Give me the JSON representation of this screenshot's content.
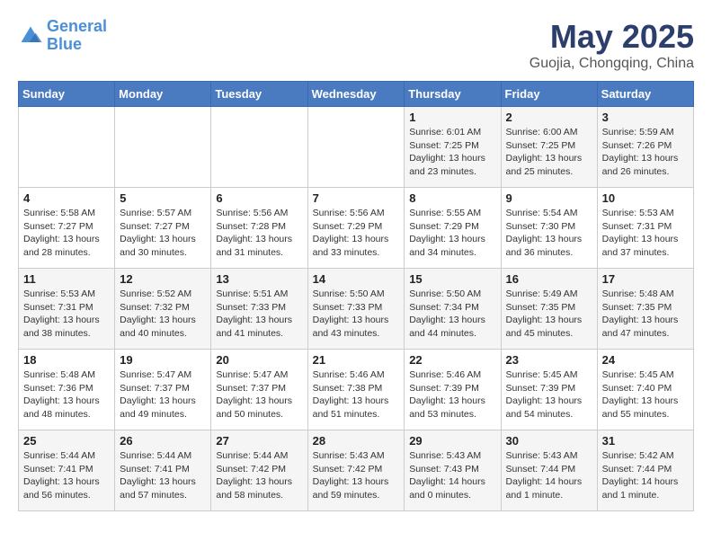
{
  "logo": {
    "line1": "General",
    "line2": "Blue"
  },
  "title": "May 2025",
  "subtitle": "Guojia, Chongqing, China",
  "days_of_week": [
    "Sunday",
    "Monday",
    "Tuesday",
    "Wednesday",
    "Thursday",
    "Friday",
    "Saturday"
  ],
  "weeks": [
    [
      {
        "day": "",
        "sunrise": "",
        "sunset": "",
        "daylight": ""
      },
      {
        "day": "",
        "sunrise": "",
        "sunset": "",
        "daylight": ""
      },
      {
        "day": "",
        "sunrise": "",
        "sunset": "",
        "daylight": ""
      },
      {
        "day": "",
        "sunrise": "",
        "sunset": "",
        "daylight": ""
      },
      {
        "day": "1",
        "sunrise": "Sunrise: 6:01 AM",
        "sunset": "Sunset: 7:25 PM",
        "daylight": "Daylight: 13 hours and 23 minutes."
      },
      {
        "day": "2",
        "sunrise": "Sunrise: 6:00 AM",
        "sunset": "Sunset: 7:25 PM",
        "daylight": "Daylight: 13 hours and 25 minutes."
      },
      {
        "day": "3",
        "sunrise": "Sunrise: 5:59 AM",
        "sunset": "Sunset: 7:26 PM",
        "daylight": "Daylight: 13 hours and 26 minutes."
      }
    ],
    [
      {
        "day": "4",
        "sunrise": "Sunrise: 5:58 AM",
        "sunset": "Sunset: 7:27 PM",
        "daylight": "Daylight: 13 hours and 28 minutes."
      },
      {
        "day": "5",
        "sunrise": "Sunrise: 5:57 AM",
        "sunset": "Sunset: 7:27 PM",
        "daylight": "Daylight: 13 hours and 30 minutes."
      },
      {
        "day": "6",
        "sunrise": "Sunrise: 5:56 AM",
        "sunset": "Sunset: 7:28 PM",
        "daylight": "Daylight: 13 hours and 31 minutes."
      },
      {
        "day": "7",
        "sunrise": "Sunrise: 5:56 AM",
        "sunset": "Sunset: 7:29 PM",
        "daylight": "Daylight: 13 hours and 33 minutes."
      },
      {
        "day": "8",
        "sunrise": "Sunrise: 5:55 AM",
        "sunset": "Sunset: 7:29 PM",
        "daylight": "Daylight: 13 hours and 34 minutes."
      },
      {
        "day": "9",
        "sunrise": "Sunrise: 5:54 AM",
        "sunset": "Sunset: 7:30 PM",
        "daylight": "Daylight: 13 hours and 36 minutes."
      },
      {
        "day": "10",
        "sunrise": "Sunrise: 5:53 AM",
        "sunset": "Sunset: 7:31 PM",
        "daylight": "Daylight: 13 hours and 37 minutes."
      }
    ],
    [
      {
        "day": "11",
        "sunrise": "Sunrise: 5:53 AM",
        "sunset": "Sunset: 7:31 PM",
        "daylight": "Daylight: 13 hours and 38 minutes."
      },
      {
        "day": "12",
        "sunrise": "Sunrise: 5:52 AM",
        "sunset": "Sunset: 7:32 PM",
        "daylight": "Daylight: 13 hours and 40 minutes."
      },
      {
        "day": "13",
        "sunrise": "Sunrise: 5:51 AM",
        "sunset": "Sunset: 7:33 PM",
        "daylight": "Daylight: 13 hours and 41 minutes."
      },
      {
        "day": "14",
        "sunrise": "Sunrise: 5:50 AM",
        "sunset": "Sunset: 7:33 PM",
        "daylight": "Daylight: 13 hours and 43 minutes."
      },
      {
        "day": "15",
        "sunrise": "Sunrise: 5:50 AM",
        "sunset": "Sunset: 7:34 PM",
        "daylight": "Daylight: 13 hours and 44 minutes."
      },
      {
        "day": "16",
        "sunrise": "Sunrise: 5:49 AM",
        "sunset": "Sunset: 7:35 PM",
        "daylight": "Daylight: 13 hours and 45 minutes."
      },
      {
        "day": "17",
        "sunrise": "Sunrise: 5:48 AM",
        "sunset": "Sunset: 7:35 PM",
        "daylight": "Daylight: 13 hours and 47 minutes."
      }
    ],
    [
      {
        "day": "18",
        "sunrise": "Sunrise: 5:48 AM",
        "sunset": "Sunset: 7:36 PM",
        "daylight": "Daylight: 13 hours and 48 minutes."
      },
      {
        "day": "19",
        "sunrise": "Sunrise: 5:47 AM",
        "sunset": "Sunset: 7:37 PM",
        "daylight": "Daylight: 13 hours and 49 minutes."
      },
      {
        "day": "20",
        "sunrise": "Sunrise: 5:47 AM",
        "sunset": "Sunset: 7:37 PM",
        "daylight": "Daylight: 13 hours and 50 minutes."
      },
      {
        "day": "21",
        "sunrise": "Sunrise: 5:46 AM",
        "sunset": "Sunset: 7:38 PM",
        "daylight": "Daylight: 13 hours and 51 minutes."
      },
      {
        "day": "22",
        "sunrise": "Sunrise: 5:46 AM",
        "sunset": "Sunset: 7:39 PM",
        "daylight": "Daylight: 13 hours and 53 minutes."
      },
      {
        "day": "23",
        "sunrise": "Sunrise: 5:45 AM",
        "sunset": "Sunset: 7:39 PM",
        "daylight": "Daylight: 13 hours and 54 minutes."
      },
      {
        "day": "24",
        "sunrise": "Sunrise: 5:45 AM",
        "sunset": "Sunset: 7:40 PM",
        "daylight": "Daylight: 13 hours and 55 minutes."
      }
    ],
    [
      {
        "day": "25",
        "sunrise": "Sunrise: 5:44 AM",
        "sunset": "Sunset: 7:41 PM",
        "daylight": "Daylight: 13 hours and 56 minutes."
      },
      {
        "day": "26",
        "sunrise": "Sunrise: 5:44 AM",
        "sunset": "Sunset: 7:41 PM",
        "daylight": "Daylight: 13 hours and 57 minutes."
      },
      {
        "day": "27",
        "sunrise": "Sunrise: 5:44 AM",
        "sunset": "Sunset: 7:42 PM",
        "daylight": "Daylight: 13 hours and 58 minutes."
      },
      {
        "day": "28",
        "sunrise": "Sunrise: 5:43 AM",
        "sunset": "Sunset: 7:42 PM",
        "daylight": "Daylight: 13 hours and 59 minutes."
      },
      {
        "day": "29",
        "sunrise": "Sunrise: 5:43 AM",
        "sunset": "Sunset: 7:43 PM",
        "daylight": "Daylight: 14 hours and 0 minutes."
      },
      {
        "day": "30",
        "sunrise": "Sunrise: 5:43 AM",
        "sunset": "Sunset: 7:44 PM",
        "daylight": "Daylight: 14 hours and 1 minute."
      },
      {
        "day": "31",
        "sunrise": "Sunrise: 5:42 AM",
        "sunset": "Sunset: 7:44 PM",
        "daylight": "Daylight: 14 hours and 1 minute."
      }
    ]
  ]
}
